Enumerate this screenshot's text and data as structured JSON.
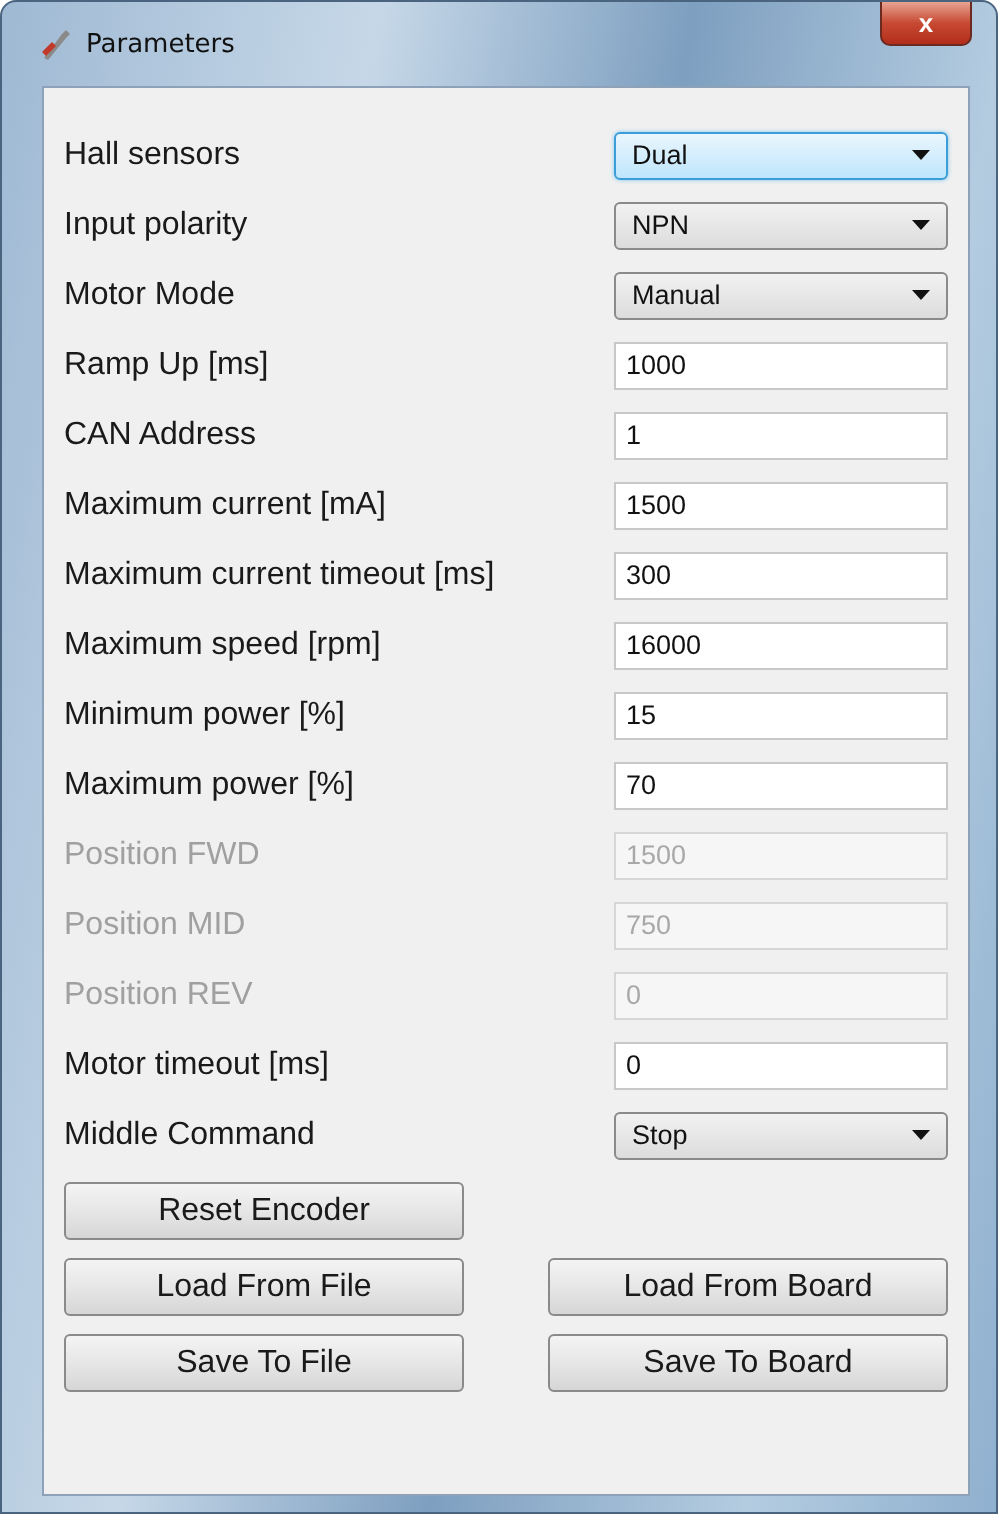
{
  "window": {
    "title": "Parameters",
    "close": "x"
  },
  "rows": [
    {
      "kind": "select",
      "label": "Hall sensors",
      "value": "Dual",
      "focused": true,
      "disabled": false
    },
    {
      "kind": "select",
      "label": "Input polarity",
      "value": "NPN",
      "focused": false,
      "disabled": false
    },
    {
      "kind": "select",
      "label": "Motor Mode",
      "value": "Manual",
      "focused": false,
      "disabled": false
    },
    {
      "kind": "text",
      "label": "Ramp Up [ms]",
      "value": "1000",
      "disabled": false
    },
    {
      "kind": "text",
      "label": "CAN Address",
      "value": "1",
      "disabled": false
    },
    {
      "kind": "text",
      "label": "Maximum current [mA]",
      "value": "1500",
      "disabled": false
    },
    {
      "kind": "text",
      "label": "Maximum current timeout [ms]",
      "value": "300",
      "disabled": false
    },
    {
      "kind": "text",
      "label": "Maximum speed [rpm]",
      "value": "16000",
      "disabled": false
    },
    {
      "kind": "text",
      "label": "Minimum power [%]",
      "value": "15",
      "disabled": false
    },
    {
      "kind": "text",
      "label": "Maximum power [%]",
      "value": "70",
      "disabled": false
    },
    {
      "kind": "text",
      "label": "Position FWD",
      "value": "1500",
      "disabled": true
    },
    {
      "kind": "text",
      "label": "Position MID",
      "value": "750",
      "disabled": true
    },
    {
      "kind": "text",
      "label": "Position REV",
      "value": "0",
      "disabled": true
    },
    {
      "kind": "text",
      "label": "Motor timeout [ms]",
      "value": "0",
      "disabled": false
    },
    {
      "kind": "select",
      "label": "Middle Command",
      "value": "Stop",
      "focused": false,
      "disabled": false
    }
  ],
  "buttons": [
    [
      "Reset Encoder"
    ],
    [
      "Load From File",
      "Load From Board"
    ],
    [
      "Save To File",
      "Save To Board"
    ]
  ]
}
